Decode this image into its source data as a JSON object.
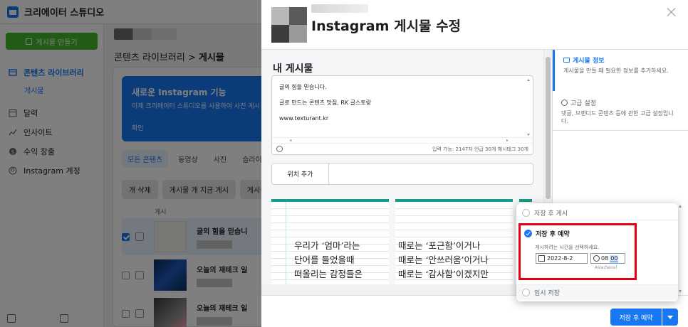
{
  "app": {
    "title": "크리에이터 스튜디오"
  },
  "sidebar": {
    "create_button": "게시물 만들기",
    "items": [
      {
        "label": "콘텐츠 라이브러리",
        "icon": "library-icon",
        "active": true
      },
      {
        "label": "달력",
        "icon": "calendar-icon"
      },
      {
        "label": "인사이트",
        "icon": "insights-icon"
      },
      {
        "label": "수익 창출",
        "icon": "monetization-icon"
      },
      {
        "label": "Instagram 계정",
        "icon": "account-icon"
      }
    ],
    "sub_item": "게시물"
  },
  "main": {
    "breadcrumb_parent": "콘텐츠 라이브러리",
    "breadcrumb_sep": ">",
    "breadcrumb_current": "게시물",
    "banner": {
      "title": "새로운 Instagram 기능",
      "text": "이제 크리에이터 스튜디오를 사용하여 사진 게시",
      "link": "확인"
    },
    "tabs": [
      "모든 콘텐츠",
      "동영상",
      "사진",
      "슬라이드"
    ],
    "actions": [
      "개 삭제",
      "게시물 개 지금 게시",
      "게시물 보"
    ],
    "column_header": "게시",
    "rows": [
      {
        "title": "글의 힘을 믿습니",
        "checked": true
      },
      {
        "title": "오늘의 재테크 일",
        "checked": false
      },
      {
        "title": "오늘의 재테크 일",
        "checked": false
      }
    ]
  },
  "modal": {
    "title": "Instagram 게시물 수정",
    "section_title": "내 게시물",
    "caption_lines": [
      "글의 힘을 믿습니다.",
      "글로 만드는 콘텐츠 맛집, RK 글스토랑",
      "www.texturant.kr"
    ],
    "char_count": "입력 가능: 2147자 언급 30개 해시태그 30개",
    "location_label": "위치 추가",
    "media_texts": [
      [
        "우리가 ‘엄마’라는",
        "단어를 들었을때",
        "떠올리는 감정들은"
      ],
      [
        "때로는 ‘포근함’이거나",
        "때로는 ‘안쓰러움’이거나",
        "때로는 ‘감사함’이겠지만"
      ]
    ],
    "right_panel": {
      "info_title": "게시물 정보",
      "info_desc": "게시물을 만들 때 필요한 정보를 추가하세요.",
      "advanced_title": "고급 설정",
      "advanced_desc": "댓글, 브랜디드 콘텐츠 등에 관한 고급 설정입니다."
    },
    "footer": {
      "primary_button": "저장 후 예약"
    }
  },
  "schedule": {
    "options": [
      "저장 후 게시",
      "저장 후 예약",
      "임시 저장"
    ],
    "selected": "저장 후 예약",
    "hint": "게시하려는 시간을 선택하세요.",
    "date": "2022-8-2",
    "time_hour": "08",
    "time_minute": "00",
    "timezone": "Asia/Seoul"
  },
  "colors": {
    "brand": "#1877f2",
    "create": "#42b72a",
    "highlight": "#e0000f",
    "teal": "#139c8a"
  }
}
